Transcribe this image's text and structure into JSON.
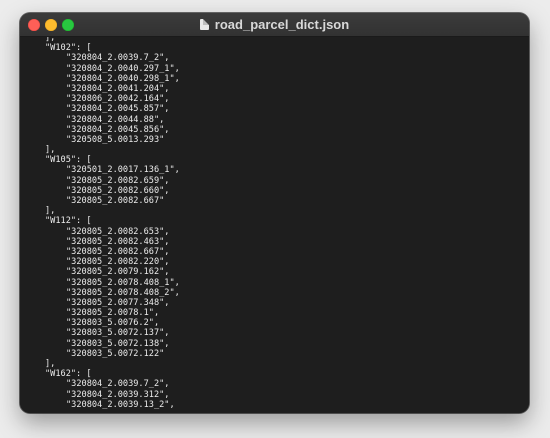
{
  "window": {
    "title": "road_parcel_dict.json",
    "title_icon": "document-icon"
  },
  "colors": {
    "background": "#1e1e1e",
    "text": "#ececec",
    "close": "#ff5f57",
    "minimize": "#febc2e",
    "zoom": "#28c840"
  },
  "lines": [
    {
      "text": "],",
      "indent": 1
    },
    {
      "text": "\"W102\": [",
      "indent": 1
    },
    {
      "text": "\"320804_2.0039.7_2\",",
      "indent": 2
    },
    {
      "text": "\"320804_2.0040.297_1\",",
      "indent": 2
    },
    {
      "text": "\"320804_2.0040.298_1\",",
      "indent": 2
    },
    {
      "text": "\"320804_2.0041.204\",",
      "indent": 2
    },
    {
      "text": "\"320806_2.0042.164\",",
      "indent": 2
    },
    {
      "text": "\"320804_2.0045.857\",",
      "indent": 2
    },
    {
      "text": "\"320804_2.0044.88\",",
      "indent": 2
    },
    {
      "text": "\"320804_2.0045.856\",",
      "indent": 2
    },
    {
      "text": "\"320508_5.0013.293\"",
      "indent": 2
    },
    {
      "text": "],",
      "indent": 1
    },
    {
      "text": "\"W105\": [",
      "indent": 1
    },
    {
      "text": "\"320501_2.0017.136_1\",",
      "indent": 2
    },
    {
      "text": "\"320805_2.0082.659\",",
      "indent": 2
    },
    {
      "text": "\"320805_2.0082.660\",",
      "indent": 2
    },
    {
      "text": "\"320805_2.0082.667\"",
      "indent": 2
    },
    {
      "text": "],",
      "indent": 1
    },
    {
      "text": "\"W112\": [",
      "indent": 1
    },
    {
      "text": "\"320805_2.0082.653\",",
      "indent": 2
    },
    {
      "text": "\"320805_2.0082.463\",",
      "indent": 2
    },
    {
      "text": "\"320805_2.0082.667\",",
      "indent": 2
    },
    {
      "text": "\"320805_2.0082.220\",",
      "indent": 2
    },
    {
      "text": "\"320805_2.0079.162\",",
      "indent": 2
    },
    {
      "text": "\"320805_2.0078.408_1\",",
      "indent": 2
    },
    {
      "text": "\"320805_2.0078.408_2\",",
      "indent": 2
    },
    {
      "text": "\"320805_2.0077.348\",",
      "indent": 2
    },
    {
      "text": "\"320805_2.0078.1\",",
      "indent": 2
    },
    {
      "text": "\"320803_5.0076.2\",",
      "indent": 2
    },
    {
      "text": "\"320803_5.0072.137\",",
      "indent": 2
    },
    {
      "text": "\"320803_5.0072.138\",",
      "indent": 2
    },
    {
      "text": "\"320803_5.0072.122\"",
      "indent": 2
    },
    {
      "text": "],",
      "indent": 1
    },
    {
      "text": "\"W162\": [",
      "indent": 1
    },
    {
      "text": "\"320804_2.0039.7_2\",",
      "indent": 2
    },
    {
      "text": "\"320804_2.0039.312\",",
      "indent": 2
    },
    {
      "text": "\"320804_2.0039.13_2\",",
      "indent": 2
    }
  ]
}
